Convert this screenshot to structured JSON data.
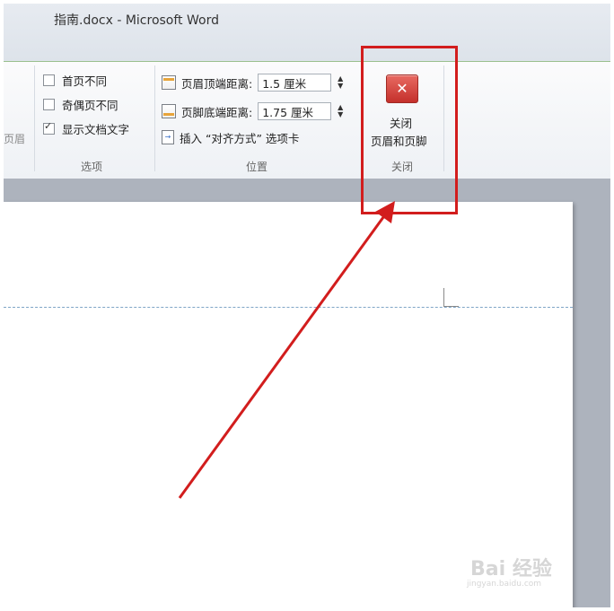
{
  "window": {
    "title": "指南.docx  -  Microsoft Word"
  },
  "ribbon": {
    "cut_text": "页眉",
    "options": {
      "group_label": "选项",
      "items": [
        {
          "label": "首页不同",
          "checked": false
        },
        {
          "label": "奇偶页不同",
          "checked": false
        },
        {
          "label": "显示文档文字",
          "checked": true
        }
      ]
    },
    "position": {
      "group_label": "位置",
      "header_top_label": "页眉顶端距离:",
      "header_top_value": "1.5 厘米",
      "footer_bottom_label": "页脚底端距离:",
      "footer_bottom_value": "1.75 厘米",
      "insert_tab_label": "插入 “对齐方式” 选项卡"
    },
    "close": {
      "group_label": "关闭",
      "button_line1": "关闭",
      "button_line2": "页眉和页脚"
    }
  },
  "annotation": {
    "highlight_color": "#d21d1d"
  },
  "watermark": {
    "brand": "Bai 经验",
    "url": "jingyan.baidu.com"
  }
}
